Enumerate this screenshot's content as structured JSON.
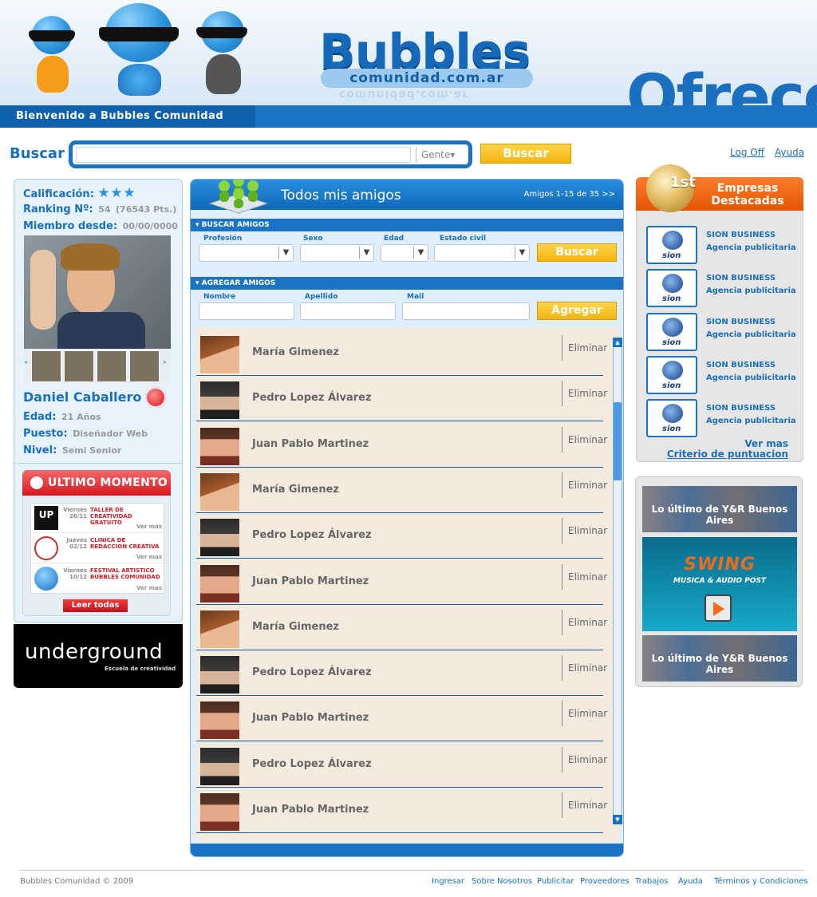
{
  "header": {
    "logo_main": "Bubbles",
    "logo_sub": "comunidad.com.ar",
    "promo_word": "Ofrecé",
    "welcome": "Bienvenido a Bubbles Comunidad"
  },
  "search": {
    "label": "Buscar",
    "placeholder": "",
    "scope": "Gente",
    "button": "Buscar"
  },
  "toplinks": {
    "logout": "Log Off",
    "help": "Ayuda"
  },
  "profile": {
    "rating_label": "Calificación:",
    "rating_stars": 3,
    "ranking_label": "Ranking Nº:",
    "ranking_value": "54",
    "ranking_points": "(76543 Pts.)",
    "member_label": "Miembro desde:",
    "member_value": "00/00/0000",
    "name": "Daniel Caballero",
    "age_label": "Edad:",
    "age_value": "21 Años",
    "job_label": "Puesto:",
    "job_value": "Diseñador Web",
    "level_label": "Nivel:",
    "level_value": "Semi Senior"
  },
  "news": {
    "title": "ULTIMO MOMENTO",
    "items": [
      {
        "day": "Viernes",
        "date": "26/11",
        "text": "TALLER DE CREATIVIDAD GRATUITO",
        "more": "Ver mas"
      },
      {
        "day": "Jueves",
        "date": "02/12",
        "text": "CLINICA DE REDACCION CREATIVA",
        "more": "Ver mas"
      },
      {
        "day": "Viernes",
        "date": "10/12",
        "text": "FESTIVAL ARTISTICO BUBBLES COMUNIDAD",
        "more": "Ver mas"
      }
    ],
    "read_all": "Leer todas"
  },
  "underground": {
    "title": "underground",
    "subtitle": "Escuela de creatividad"
  },
  "friends": {
    "title": "Todos mis amigos",
    "count": "Amigos 1-15 de 35 >>",
    "search_section": "BUSCAR AMIGOS",
    "filters": {
      "profession": "Profesión",
      "sex": "Sexo",
      "age": "Edad",
      "civil": "Estado civil"
    },
    "search_button": "Buscar",
    "add_section": "AGREGAR AMIGOS",
    "add_fields": {
      "name": "Nombre",
      "lastname": "Apellido",
      "mail": "Mail"
    },
    "add_button": "Agregar",
    "delete_label": "Eliminar",
    "list": [
      {
        "name": "María Gimenez",
        "avatar": "f"
      },
      {
        "name": "Pedro Lopez Álvarez",
        "avatar": "m1"
      },
      {
        "name": "Juan Pablo Martinez",
        "avatar": "m2"
      },
      {
        "name": "María Gimenez",
        "avatar": "f"
      },
      {
        "name": "Pedro Lopez Álvarez",
        "avatar": "m1"
      },
      {
        "name": "Juan Pablo Martinez",
        "avatar": "m2"
      },
      {
        "name": "María Gimenez",
        "avatar": "f"
      },
      {
        "name": "Pedro Lopez Álvarez",
        "avatar": "m1"
      },
      {
        "name": "Juan Pablo Martinez",
        "avatar": "m2"
      },
      {
        "name": "Pedro Lopez Álvarez",
        "avatar": "m1"
      },
      {
        "name": "Juan Pablo Martinez",
        "avatar": "m2"
      }
    ]
  },
  "companies": {
    "title": "Empresas Destacadas",
    "medal": "1st",
    "items": [
      {
        "logo": "sion",
        "name": "SION BUSINESS",
        "type": "Agencia publicitaria"
      },
      {
        "logo": "sion",
        "name": "SION BUSINESS",
        "type": "Agencia publicitaria"
      },
      {
        "logo": "sion",
        "name": "SION BUSINESS",
        "type": "Agencia publicitaria"
      },
      {
        "logo": "sion",
        "name": "SION BUSINESS",
        "type": "Agencia publicitaria"
      },
      {
        "logo": "sion",
        "name": "SION BUSINESS",
        "type": "Agencia publicitaria"
      }
    ],
    "see_more": "Ver mas",
    "criteria": "Criterio de puntuacion"
  },
  "ads": {
    "yr_text_prefix": "Lo último de ",
    "yr_text_brand": "Y&R Buenos Aires",
    "swing_title": "SWING",
    "swing_sub": "MUSICA & AUDIO POST"
  },
  "footer": {
    "copyright": "Bubbles Comunidad  © 2009",
    "links": [
      "Ingresar",
      "Sobre Nosotros",
      "Publicitar",
      "Proveedores",
      "Trabajos",
      "Ayuda",
      "Términos y Condiciones"
    ]
  },
  "colors": {
    "primary": "#1a73c4",
    "accent_yellow": "#f3b410",
    "accent_red": "#d8151c",
    "accent_orange": "#e45606",
    "list_bg": "#f4ebde"
  }
}
